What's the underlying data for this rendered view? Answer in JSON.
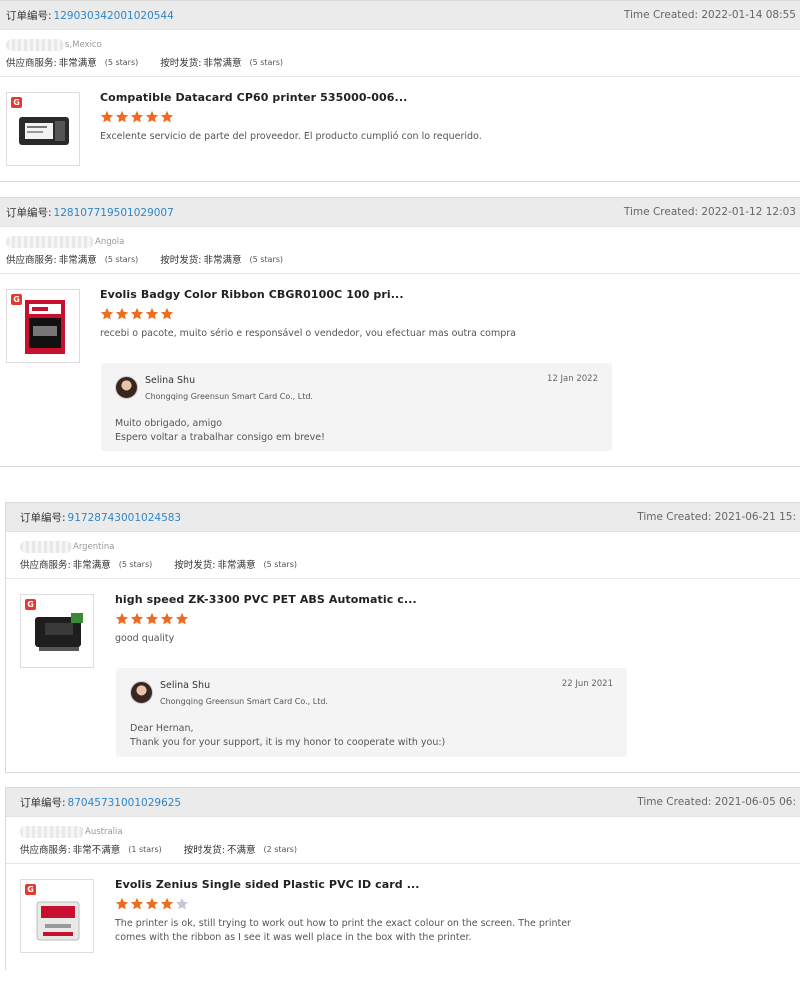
{
  "labels": {
    "order_no": "订单编号:",
    "supplier_service": "供应商服务:",
    "on_time_shipping": "按时发货:"
  },
  "orders": [
    {
      "order_number": "129030342001020544",
      "time_created": "Time Created: 2022-01-14 08:55",
      "buyer_location": "s,Mexico",
      "supplier_rating": "非常满意",
      "supplier_stars": "(5 stars)",
      "shipping_rating": "非常满意",
      "shipping_stars": "(5 stars)",
      "product_title": "Compatible Datacard CP60 printer 535000-006...",
      "product_rating": 5,
      "review": "Excelente servicio de parte del proveedor. El producto cumplió con lo requerido."
    },
    {
      "order_number": "128107719501029007",
      "time_created": "Time Created: 2022-01-12 12:03",
      "buyer_location": "Angola",
      "supplier_rating": "非常满意",
      "supplier_stars": "(5 stars)",
      "shipping_rating": "非常满意",
      "shipping_stars": "(5 stars)",
      "product_title": "Evolis Badgy Color Ribbon CBGR0100C 100 pri...",
      "product_rating": 5,
      "review": "recebi o pacote, muito sério e responsável o vendedor, vou efectuar mas outra compra",
      "reply": {
        "name": "Selina Shu",
        "company": "Chongqing Greensun Smart Card Co., Ltd.",
        "date": "12 Jan 2022",
        "message": "Muito obrigado, amigo\nEspero voltar a trabalhar consigo em breve!"
      }
    },
    {
      "order_number": "91728743001024583",
      "time_created": "Time Created: 2021-06-21 15:",
      "buyer_location": "Argentina",
      "supplier_rating": "非常满意",
      "supplier_stars": "(5 stars)",
      "shipping_rating": "非常满意",
      "shipping_stars": "(5 stars)",
      "product_title": "high speed ZK-3300 PVC PET ABS Automatic c...",
      "product_rating": 5,
      "review": "good quality",
      "reply": {
        "name": "Selina Shu",
        "company": "Chongqing Greensun Smart Card Co., Ltd.",
        "date": "22 Jun 2021",
        "message": "Dear Hernan,\nThank you for your support, it is my honor to cooperate with you:)"
      }
    },
    {
      "order_number": "87045731001029625",
      "time_created": "Time Created: 2021-06-05 06:",
      "buyer_location": "Australia",
      "supplier_rating": "非常不满意",
      "supplier_stars": "(1 stars)",
      "shipping_rating": "不满意",
      "shipping_stars": "(2 stars)",
      "product_title": "Evolis Zenius Single sided Plastic PVC ID card ...",
      "product_rating": 4,
      "review": "The printer is ok, still trying to work out how to print the exact colour on the screen. The printer comes with the ribbon as I see it was well place in the box with the printer."
    }
  ],
  "icons": {
    "brand_logo": "greensun-logo-icon",
    "star": "star-icon",
    "avatar": "seller-avatar"
  },
  "colors": {
    "star_on": "#ef6b1d",
    "star_off": "#c4c8d6",
    "order_link": "#2f86c8"
  }
}
